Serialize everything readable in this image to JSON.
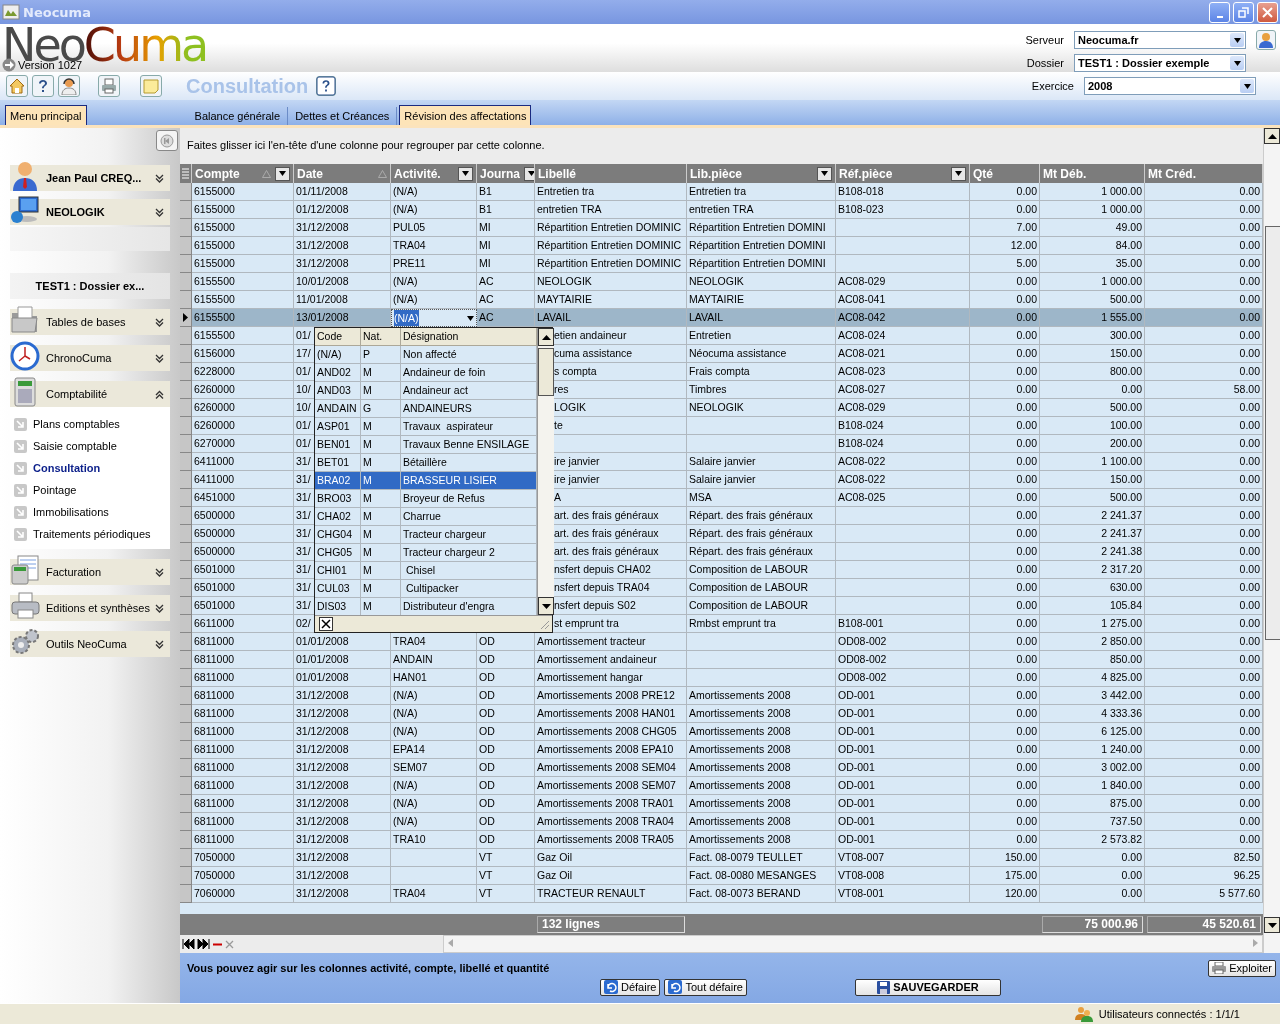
{
  "window": {
    "title": "Neocuma"
  },
  "header": {
    "logo": {
      "part_1": "Neo",
      "part_2": "Cuma"
    },
    "version": "Version 1027",
    "page_title": "Consultation",
    "fields": [
      {
        "label": "Serveur",
        "value": "Neocuma.fr"
      },
      {
        "label": "Dossier",
        "value": "TEST1 : Dossier exemple"
      },
      {
        "label": "Exercice",
        "value": "2008"
      }
    ]
  },
  "menu_button": "Menu principal",
  "tabs": [
    {
      "label": "Balance générale",
      "selected": false
    },
    {
      "label": "Dettes et Créances",
      "selected": false
    },
    {
      "label": "Révision des affectations",
      "selected": true
    }
  ],
  "sidebar": {
    "sections": [
      {
        "kind": "account",
        "label": "Jean Paul CREQ...",
        "expanded": false
      },
      {
        "kind": "account",
        "label": "NEOLOGIK",
        "expanded": false
      },
      {
        "kind": "info",
        "label": "TEST1 : Dossier ex..."
      },
      {
        "kind": "module",
        "label": "Tables de bases",
        "expanded": false
      },
      {
        "kind": "module",
        "label": "ChronoCuma",
        "expanded": false
      },
      {
        "kind": "module",
        "label": "Comptabilité",
        "expanded": true,
        "items": [
          {
            "label": "Plans comptables",
            "selected": false
          },
          {
            "label": "Saisie comptable",
            "selected": false
          },
          {
            "label": "Consultation",
            "selected": true
          },
          {
            "label": "Pointage",
            "selected": false
          },
          {
            "label": "Immobilisations",
            "selected": false
          },
          {
            "label": "Traitements périodiques",
            "selected": false
          }
        ]
      },
      {
        "kind": "module",
        "label": "Facturation",
        "expanded": false
      },
      {
        "kind": "module",
        "label": "Editions et synthèses",
        "expanded": false
      },
      {
        "kind": "module",
        "label": "Outils NeoCuma",
        "expanded": false
      }
    ]
  },
  "grid": {
    "group_hint": "Faites glisser ici l'en-tête d'une colonne pour regrouper par cette colonne.",
    "columns": [
      {
        "label": "Compte",
        "sort_mark": true,
        "filter_button": true
      },
      {
        "label": "Date",
        "sort_mark": true,
        "filter_button": false
      },
      {
        "label": "Activité.",
        "sort_mark": false,
        "filter_button": true
      },
      {
        "label": "Journa",
        "sort_mark": false,
        "filter_button": true
      },
      {
        "label": "Libellé",
        "sort_mark": false,
        "filter_button": false
      },
      {
        "label": "Lib.pièce",
        "sort_mark": false,
        "filter_button": true
      },
      {
        "label": "Réf.pièce",
        "sort_mark": false,
        "filter_button": true
      },
      {
        "label": "Qté",
        "sort_mark": false,
        "filter_button": false
      },
      {
        "label": "Mt Déb.",
        "sort_mark": false,
        "filter_button": false
      },
      {
        "label": "Mt Créd.",
        "sort_mark": false,
        "filter_button": false
      }
    ],
    "rows": [
      {
        "compte": "6155000",
        "date": "01/11/2008",
        "activite": "(N/A)",
        "journal": "B1",
        "libelle": "Entretien tra",
        "lib_piece": "Entretien tra",
        "ref_piece": "B108-018",
        "qte": "0.00",
        "mt_deb": "1 000.00",
        "mt_cred": "0.00",
        "selected": false
      },
      {
        "compte": "6155000",
        "date": "01/12/2008",
        "activite": "(N/A)",
        "journal": "B1",
        "libelle": "entretien TRA",
        "lib_piece": "entretien TRA",
        "ref_piece": "B108-023",
        "qte": "0.00",
        "mt_deb": "1 000.00",
        "mt_cred": "0.00",
        "selected": false
      },
      {
        "compte": "6155000",
        "date": "31/12/2008",
        "activite": "PUL05",
        "journal": "MI",
        "libelle": "Répartition Entretien DOMINIC",
        "lib_piece": "Répartition Entretien DOMINI",
        "qte": "7.00",
        "mt_deb": "49.00",
        "mt_cred": "0.00",
        "selected": false
      },
      {
        "compte": "6155000",
        "date": "31/12/2008",
        "activite": "TRA04",
        "journal": "MI",
        "libelle": "Répartition Entretien DOMINIC",
        "lib_piece": "Répartition Entretien DOMINI",
        "qte": "12.00",
        "mt_deb": "84.00",
        "mt_cred": "0.00",
        "selected": false
      },
      {
        "compte": "6155000",
        "date": "31/12/2008",
        "activite": "PRE11",
        "journal": "MI",
        "libelle": "Répartition Entretien DOMINIC",
        "lib_piece": "Répartition Entretien DOMINI",
        "qte": "5.00",
        "mt_deb": "35.00",
        "mt_cred": "0.00",
        "selected": false
      },
      {
        "compte": "6155500",
        "date": "10/01/2008",
        "activite": "(N/A)",
        "journal": "AC",
        "libelle": "NEOLOGIK",
        "lib_piece": "NEOLOGIK",
        "ref_piece": "AC08-029",
        "qte": "0.00",
        "mt_deb": "1 000.00",
        "mt_cred": "0.00",
        "selected": false
      },
      {
        "compte": "6155500",
        "date": "11/01/2008",
        "activite": "(N/A)",
        "journal": "AC",
        "libelle": "MAYTAIRIE",
        "lib_piece": "MAYTAIRIE",
        "ref_piece": "AC08-041",
        "qte": "0.00",
        "mt_deb": "500.00",
        "mt_cred": "0.00",
        "selected": false
      },
      {
        "compte": "6155500",
        "date": "13/01/2008",
        "activite": "(N/A)",
        "journal": "AC",
        "libelle": "LAVAIL",
        "lib_piece": "LAVAIL",
        "ref_piece": "AC08-042",
        "qte": "0.00",
        "mt_deb": "1 555.00",
        "mt_cred": "0.00",
        "selected": true
      },
      {
        "compte": "6155500",
        "date": "01/",
        "libelle": "etien andaineur",
        "lib_piece": "Entretien",
        "ref_piece": "AC08-024",
        "qte": "0.00",
        "mt_deb": "300.00",
        "mt_cred": "0.00",
        "selected": false
      },
      {
        "compte": "6156000",
        "date": "17/",
        "libelle": "cuma assistance",
        "lib_piece": "Néocuma assistance",
        "ref_piece": "AC08-021",
        "qte": "0.00",
        "mt_deb": "150.00",
        "mt_cred": "0.00",
        "selected": false
      },
      {
        "compte": "6228000",
        "date": "01/",
        "libelle": "s compta",
        "lib_piece": "Frais compta",
        "ref_piece": "AC08-023",
        "qte": "0.00",
        "mt_deb": "800.00",
        "mt_cred": "0.00",
        "selected": false
      },
      {
        "compte": "6260000",
        "date": "10/",
        "libelle": "res",
        "lib_piece": "Timbres",
        "ref_piece": "AC08-027",
        "qte": "0.00",
        "mt_deb": "0.00",
        "mt_cred": "58.00",
        "selected": false
      },
      {
        "compte": "6260000",
        "date": "10/",
        "libelle": "LOGIK",
        "lib_piece": "NEOLOGIK",
        "ref_piece": "AC08-029",
        "qte": "0.00",
        "mt_deb": "500.00",
        "mt_cred": "0.00",
        "selected": false
      },
      {
        "compte": "6260000",
        "date": "01/",
        "libelle": "te",
        "ref_piece": "B108-024",
        "qte": "0.00",
        "mt_deb": "100.00",
        "mt_cred": "0.00",
        "selected": false
      },
      {
        "compte": "6270000",
        "date": "01/",
        "ref_piece": "B108-024",
        "qte": "0.00",
        "mt_deb": "200.00",
        "mt_cred": "0.00",
        "selected": false
      },
      {
        "compte": "6411000",
        "date": "31/",
        "libelle": "ire janvier",
        "lib_piece": "Salaire janvier",
        "ref_piece": "AC08-022",
        "qte": "0.00",
        "mt_deb": "1 100.00",
        "mt_cred": "0.00",
        "selected": false
      },
      {
        "compte": "6411000",
        "date": "31/",
        "libelle": "ire janvier",
        "lib_piece": "Salaire janvier",
        "ref_piece": "AC08-022",
        "qte": "0.00",
        "mt_deb": "150.00",
        "mt_cred": "0.00",
        "selected": false
      },
      {
        "compte": "6451000",
        "date": "31/",
        "libelle": "A",
        "lib_piece": "MSA",
        "ref_piece": "AC08-025",
        "qte": "0.00",
        "mt_deb": "500.00",
        "mt_cred": "0.00",
        "selected": false
      },
      {
        "compte": "6500000",
        "date": "31/",
        "libelle": "art. des frais généraux",
        "lib_piece": "Répart. des frais généraux",
        "qte": "0.00",
        "mt_deb": "2 241.37",
        "mt_cred": "0.00",
        "selected": false
      },
      {
        "compte": "6500000",
        "date": "31/",
        "libelle": "art. des frais généraux",
        "lib_piece": "Répart. des frais généraux",
        "qte": "0.00",
        "mt_deb": "2 241.37",
        "mt_cred": "0.00",
        "selected": false
      },
      {
        "compte": "6500000",
        "date": "31/",
        "libelle": "art. des frais généraux",
        "lib_piece": "Répart. des frais généraux",
        "qte": "0.00",
        "mt_deb": "2 241.38",
        "mt_cred": "0.00",
        "selected": false
      },
      {
        "compte": "6501000",
        "date": "31/",
        "libelle": "nsfert depuis CHA02",
        "lib_piece": "Composition de LABOUR",
        "qte": "0.00",
        "mt_deb": "2 317.20",
        "mt_cred": "0.00",
        "selected": false
      },
      {
        "compte": "6501000",
        "date": "31/",
        "libelle": "nsfert depuis TRA04",
        "lib_piece": "Composition de LABOUR",
        "qte": "0.00",
        "mt_deb": "630.00",
        "mt_cred": "0.00",
        "selected": false
      },
      {
        "compte": "6501000",
        "date": "31/",
        "libelle": "nsfert depuis S02",
        "lib_piece": "Composition de LABOUR",
        "qte": "0.00",
        "mt_deb": "105.84",
        "mt_cred": "0.00",
        "selected": false
      },
      {
        "compte": "6611000",
        "date": "02/",
        "libelle": "st emprunt tra",
        "lib_piece": "Rmbst emprunt tra",
        "ref_piece": "B108-001",
        "qte": "0.00",
        "mt_deb": "1 275.00",
        "mt_cred": "0.00",
        "selected": false
      },
      {
        "compte": "6811000",
        "date": "01/01/2008",
        "activite": "TRA04",
        "journal": "OD",
        "libelle": "Amortissement tracteur",
        "ref_piece": "OD08-002",
        "qte": "0.00",
        "mt_deb": "2 850.00",
        "mt_cred": "0.00",
        "selected": false
      },
      {
        "compte": "6811000",
        "date": "01/01/2008",
        "activite": "ANDAIN",
        "journal": "OD",
        "libelle": "Amortissement andaineur",
        "ref_piece": "OD08-002",
        "qte": "0.00",
        "mt_deb": "850.00",
        "mt_cred": "0.00",
        "selected": false
      },
      {
        "compte": "6811000",
        "date": "01/01/2008",
        "activite": "HAN01",
        "journal": "OD",
        "libelle": "Amortissement hangar",
        "ref_piece": "OD08-002",
        "qte": "0.00",
        "mt_deb": "4 825.00",
        "mt_cred": "0.00",
        "selected": false
      },
      {
        "compte": "6811000",
        "date": "31/12/2008",
        "activite": "(N/A)",
        "journal": "OD",
        "libelle": "Amortissements 2008 PRE12",
        "lib_piece": "Amortissements 2008",
        "ref_piece": "OD-001",
        "qte": "0.00",
        "mt_deb": "3 442.00",
        "mt_cred": "0.00",
        "selected": false
      },
      {
        "compte": "6811000",
        "date": "31/12/2008",
        "activite": "(N/A)",
        "journal": "OD",
        "libelle": "Amortissements 2008 HAN01",
        "lib_piece": "Amortissements 2008",
        "ref_piece": "OD-001",
        "qte": "0.00",
        "mt_deb": "4 333.36",
        "mt_cred": "0.00",
        "selected": false
      },
      {
        "compte": "6811000",
        "date": "31/12/2008",
        "activite": "(N/A)",
        "journal": "OD",
        "libelle": "Amortissements 2008 CHG05",
        "lib_piece": "Amortissements 2008",
        "ref_piece": "OD-001",
        "qte": "0.00",
        "mt_deb": "6 125.00",
        "mt_cred": "0.00",
        "selected": false
      },
      {
        "compte": "6811000",
        "date": "31/12/2008",
        "activite": "EPA14",
        "journal": "OD",
        "libelle": "Amortissements 2008 EPA10",
        "lib_piece": "Amortissements 2008",
        "ref_piece": "OD-001",
        "qte": "0.00",
        "mt_deb": "1 240.00",
        "mt_cred": "0.00",
        "selected": false
      },
      {
        "compte": "6811000",
        "date": "31/12/2008",
        "activite": "SEM07",
        "journal": "OD",
        "libelle": "Amortissements 2008 SEM04",
        "lib_piece": "Amortissements 2008",
        "ref_piece": "OD-001",
        "qte": "0.00",
        "mt_deb": "3 002.00",
        "mt_cred": "0.00",
        "selected": false
      },
      {
        "compte": "6811000",
        "date": "31/12/2008",
        "activite": "(N/A)",
        "journal": "OD",
        "libelle": "Amortissements 2008 SEM07",
        "lib_piece": "Amortissements 2008",
        "ref_piece": "OD-001",
        "qte": "0.00",
        "mt_deb": "1 840.00",
        "mt_cred": "0.00",
        "selected": false
      },
      {
        "compte": "6811000",
        "date": "31/12/2008",
        "activite": "(N/A)",
        "journal": "OD",
        "libelle": "Amortissements 2008 TRA01",
        "lib_piece": "Amortissements 2008",
        "ref_piece": "OD-001",
        "qte": "0.00",
        "mt_deb": "875.00",
        "mt_cred": "0.00",
        "selected": false
      },
      {
        "compte": "6811000",
        "date": "31/12/2008",
        "activite": "(N/A)",
        "journal": "OD",
        "libelle": "Amortissements 2008 TRA04",
        "lib_piece": "Amortissements 2008",
        "ref_piece": "OD-001",
        "qte": "0.00",
        "mt_deb": "737.50",
        "mt_cred": "0.00",
        "selected": false
      },
      {
        "compte": "6811000",
        "date": "31/12/2008",
        "activite": "TRA10",
        "journal": "OD",
        "libelle": "Amortissements 2008 TRA05",
        "lib_piece": "Amortissements 2008",
        "ref_piece": "OD-001",
        "qte": "0.00",
        "mt_deb": "2 573.82",
        "mt_cred": "0.00",
        "selected": false
      },
      {
        "compte": "7050000",
        "date": "31/12/2008",
        "journal": "VT",
        "libelle": "Gaz Oil",
        "lib_piece": "Fact. 08-0079 TEULLET",
        "ref_piece": "VT08-007",
        "qte": "150.00",
        "mt_deb": "0.00",
        "mt_cred": "82.50",
        "selected": false
      },
      {
        "compte": "7050000",
        "date": "31/12/2008",
        "journal": "VT",
        "libelle": "Gaz Oil",
        "lib_piece": "Fact. 08-0080 MESANGES",
        "ref_piece": "VT08-008",
        "qte": "175.00",
        "mt_deb": "0.00",
        "mt_cred": "96.25",
        "selected": false
      },
      {
        "compte": "7060000",
        "date": "31/12/2008",
        "activite": "TRA04",
        "journal": "VT",
        "libelle": "TRACTEUR RENAULT",
        "lib_piece": "Fact. 08-0073 BERAND",
        "ref_piece": "VT08-001",
        "qte": "120.00",
        "mt_deb": "0.00",
        "mt_cred": "5 577.60",
        "selected": false
      }
    ],
    "footer": {
      "row_count": "132 lignes",
      "total_debit": "75 000.96",
      "total_credit": "45 520.61"
    },
    "activity_popup": {
      "columns": [
        "Code",
        "Nat.",
        "Désignation"
      ],
      "items": [
        {
          "code": "(N/A)",
          "nat": "P",
          "designation": "Non affecté",
          "selected": false
        },
        {
          "code": "AND02",
          "nat": "M",
          "designation": "Andaineur de foin",
          "selected": false
        },
        {
          "code": "AND03",
          "nat": "M",
          "designation": "Andaineur act",
          "selected": false
        },
        {
          "code": "ANDAIN",
          "nat": "G",
          "designation": "ANDAINEURS",
          "selected": false
        },
        {
          "code": "ASP01",
          "nat": "M",
          "designation": "Travaux  aspirateur",
          "selected": false
        },
        {
          "code": "BEN01",
          "nat": "M",
          "designation": "Travaux Benne ENSILAGE",
          "selected": false
        },
        {
          "code": "BET01",
          "nat": "M",
          "designation": "Bétaillère",
          "selected": false
        },
        {
          "code": "BRA02",
          "nat": "M",
          "designation": "BRASSEUR LISIER",
          "selected": true
        },
        {
          "code": "BRO03",
          "nat": "M",
          "designation": "Broyeur de Refus",
          "selected": false
        },
        {
          "code": "CHA02",
          "nat": "M",
          "designation": "Charrue",
          "selected": false
        },
        {
          "code": "CHG04",
          "nat": "M",
          "designation": "Tracteur chargeur",
          "selected": false
        },
        {
          "code": "CHG05",
          "nat": "M",
          "designation": "Tracteur chargeur 2",
          "selected": false
        },
        {
          "code": "CHI01",
          "nat": "M",
          "designation": " Chisel",
          "selected": false
        },
        {
          "code": "CUL03",
          "nat": "M",
          "designation": " Cultipacker",
          "selected": false
        },
        {
          "code": "DIS03",
          "nat": "M",
          "designation": "Distributeur d'engra",
          "selected": false
        }
      ]
    }
  },
  "bottom": {
    "message": "Vous pouvez agir sur les colonnes activité, compte, libellé et quantité",
    "export_button": "Exploiter",
    "undo_button": "Défaire",
    "undo_all_button": "Tout défaire",
    "save_button": "SAUVEGARDER"
  },
  "status_bar": {
    "users": "Utilisateurs connectés : 1/1/1"
  }
}
